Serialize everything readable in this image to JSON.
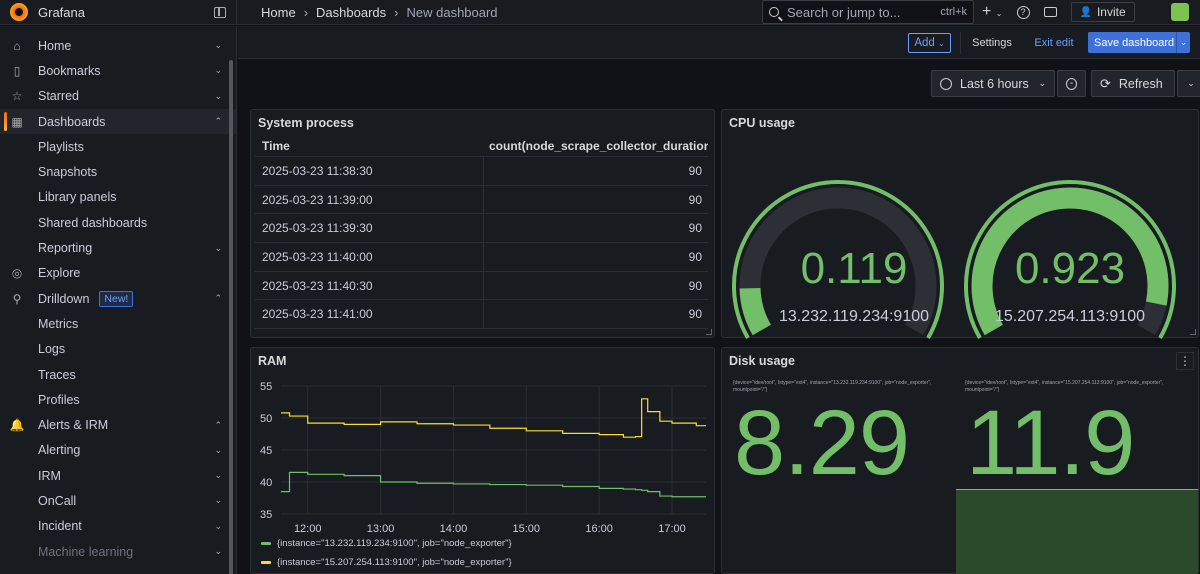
{
  "topbar": {
    "brand": "Grafana",
    "breadcrumbs": [
      "Home",
      "Dashboards",
      "New dashboard"
    ],
    "search_placeholder": "Search or jump to...",
    "search_shortcut": "ctrl+k",
    "invite_label": "Invite"
  },
  "sidebar": {
    "items": [
      {
        "label": "Home",
        "icon": "home-icon",
        "chev": "v"
      },
      {
        "label": "Bookmarks",
        "icon": "bookmark-icon",
        "chev": "v"
      },
      {
        "label": "Starred",
        "icon": "star-icon",
        "chev": "v"
      },
      {
        "label": "Dashboards",
        "icon": "apps-icon",
        "chev": "^"
      },
      {
        "label": "Playlists"
      },
      {
        "label": "Snapshots"
      },
      {
        "label": "Library panels"
      },
      {
        "label": "Shared dashboards"
      },
      {
        "label": "Reporting",
        "chev": "v"
      },
      {
        "label": "Explore",
        "icon": "compass-icon"
      },
      {
        "label": "Drilldown",
        "icon": "microscope-icon",
        "chev": "^",
        "badge": "New!"
      },
      {
        "label": "Metrics"
      },
      {
        "label": "Logs"
      },
      {
        "label": "Traces"
      },
      {
        "label": "Profiles"
      },
      {
        "label": "Alerts & IRM",
        "icon": "bell-icon",
        "chev": "^"
      },
      {
        "label": "Alerting",
        "chev": "v"
      },
      {
        "label": "IRM",
        "chev": "v"
      },
      {
        "label": "OnCall",
        "chev": "v"
      },
      {
        "label": "Incident",
        "chev": "v"
      },
      {
        "label": "Machine learning",
        "chev": "v"
      }
    ]
  },
  "actions": {
    "add_label": "Add",
    "settings_label": "Settings",
    "exit_label": "Exit edit",
    "save_label": "Save dashboard"
  },
  "time": {
    "range_label": "Last 6 hours",
    "refresh_label": "Refresh"
  },
  "panels": {
    "system_process": {
      "title": "System process",
      "columns": [
        "Time",
        "count(node_scrape_collector_duration_s"
      ],
      "rows": [
        [
          "2025-03-23 11:38:30",
          "90"
        ],
        [
          "2025-03-23 11:39:00",
          "90"
        ],
        [
          "2025-03-23 11:39:30",
          "90"
        ],
        [
          "2025-03-23 11:40:00",
          "90"
        ],
        [
          "2025-03-23 11:40:30",
          "90"
        ],
        [
          "2025-03-23 11:41:00",
          "90"
        ]
      ]
    },
    "cpu": {
      "title": "CPU usage",
      "gauges": [
        {
          "value": "0.119",
          "label": "13.232.119.234:9100",
          "fraction": 0.119
        },
        {
          "value": "0.923",
          "label": "15.207.254.113:9100",
          "fraction": 0.923
        }
      ],
      "color": "#73bf69"
    },
    "ram": {
      "title": "RAM",
      "legend": [
        {
          "label": "{instance=\"13.232.119.234:9100\", job=\"node_exporter\"}",
          "color": "#73bf69"
        },
        {
          "label": "{instance=\"15.207.254.113:9100\", job=\"node_exporter\"}",
          "color": "#fade2a"
        }
      ]
    },
    "disk": {
      "title": "Disk usage",
      "stats": [
        {
          "label": "{device=\"/dev/root\", fstype=\"ext4\", instance=\"13.232.119.234:9100\", job=\"node_exporter\", mountpoint=\"/\"}",
          "value": "8.29"
        },
        {
          "label": "{device=\"/dev/root\", fstype=\"ext4\", instance=\"15.207.254.113:9100\", job=\"node_exporter\", mountpoint=\"/\"}",
          "value": "11.9"
        }
      ]
    }
  },
  "chart_data": {
    "type": "line",
    "x": [
      "11:38",
      "11:45",
      "12:00",
      "12:30",
      "13:00",
      "13:30",
      "14:00",
      "14:30",
      "15:00",
      "15:30",
      "16:00",
      "16:20",
      "16:30",
      "16:35",
      "16:40",
      "16:50",
      "17:00",
      "17:20"
    ],
    "x_ticks": [
      "12:00",
      "13:00",
      "14:00",
      "15:00",
      "16:00",
      "17:00"
    ],
    "y_ticks": [
      "55",
      "50",
      "45",
      "40",
      "35"
    ],
    "ylim": [
      35,
      55
    ],
    "series": [
      {
        "name": "{instance=\"13.232.119.234:9100\", job=\"node_exporter\"}",
        "color": "#73bf69",
        "values": [
          38.5,
          41.5,
          41.2,
          41.0,
          40.0,
          39.8,
          39.7,
          39.6,
          39.5,
          39.3,
          39.0,
          38.9,
          38.8,
          38.7,
          38.5,
          37.8,
          37.7,
          37.7
        ]
      },
      {
        "name": "{instance=\"15.207.254.113:9100\", job=\"node_exporter\"}",
        "color": "#fade2a",
        "values": [
          50.8,
          50.3,
          49.2,
          49.0,
          49.4,
          49.1,
          48.9,
          48.4,
          48.0,
          47.6,
          47.4,
          47.0,
          47.1,
          53.0,
          51.0,
          49.5,
          49.2,
          48.8
        ]
      }
    ]
  }
}
